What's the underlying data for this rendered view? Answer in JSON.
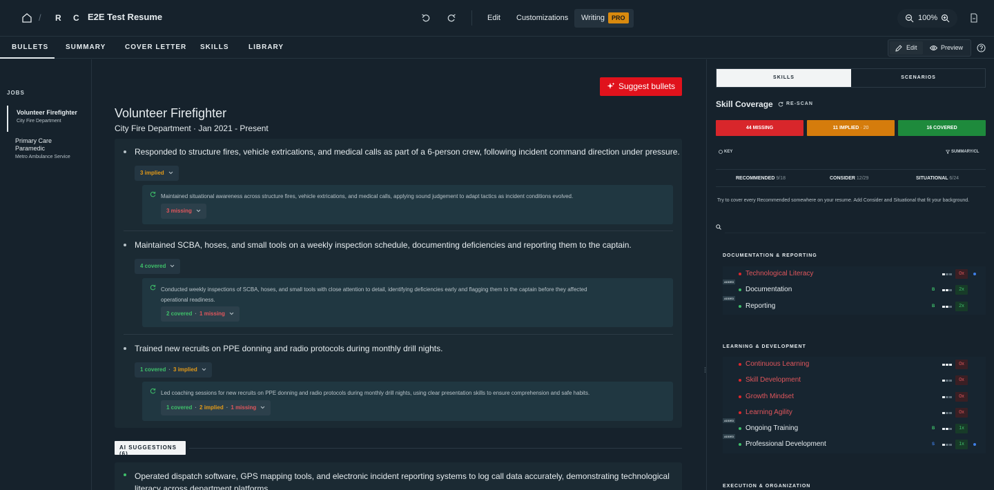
{
  "topbar": {
    "breadcrumb_sep": "/",
    "r": "R",
    "c": "C",
    "doc_title": "E2E Test Resume",
    "edit": "Edit",
    "customizations": "Customizations",
    "writing": "Writing",
    "pro": "PRO",
    "zoom": "100%"
  },
  "tabs": [
    "BULLETS",
    "SUMMARY",
    "COVER LETTER",
    "SKILLS",
    "LIBRARY"
  ],
  "view_toggle": {
    "edit": "Edit",
    "preview": "Preview"
  },
  "sidebar": {
    "heading": "JOBS",
    "jobs": [
      {
        "title": "Volunteer Firefighter",
        "org": "City Fire Department"
      },
      {
        "title_line1": "Primary Care",
        "title_line2": "Paramedic",
        "org": "Metro Ambulance Service"
      }
    ]
  },
  "main": {
    "suggest_button": "Suggest bullets",
    "job_title": "Volunteer Firefighter",
    "job_subtitle": "City Fire Department · Jan 2021 - Present",
    "bullets": [
      {
        "text": "Responded to structure fires, vehicle extrications, and medical calls as part of a 6-person crew, following incident command direction under pressure.",
        "pill": {
          "implied": "3 implied"
        },
        "rewrite": "Maintained situational awareness across structure fires, vehicle extrications, and medical calls, applying sound judgement to adapt tactics as incident conditions evolved.",
        "rewrite_pill": {
          "missing": "3 missing"
        }
      },
      {
        "text": "Maintained SCBA, hoses, and small tools on a weekly inspection schedule, documenting deficiencies and reporting them to the captain.",
        "pill": {
          "covered": "4 covered"
        },
        "rewrite_line1": "Conducted weekly inspections of SCBA, hoses, and small tools with close attention to detail, identifying deficiencies early and flagging them to the captain before they affected",
        "rewrite_line2": "operational readiness.",
        "rewrite_pill": {
          "covered": "2 covered",
          "missing": "1 missing"
        }
      },
      {
        "text": "Trained new recruits on PPE donning and radio protocols during monthly drill nights.",
        "pill": {
          "covered": "1 covered",
          "implied": "3 implied"
        },
        "rewrite": "Led coaching sessions for new recruits on PPE donning and radio protocols during monthly drill nights, using clear presentation skills to ensure comprehension and safe habits.",
        "rewrite_pill": {
          "covered": "1 covered",
          "implied": "2 implied",
          "missing": "1 missing"
        }
      }
    ],
    "ai_tag": "AI SUGGESTIONS (6)",
    "ai_suggestion_line1": "Operated dispatch software, GPS mapping tools, and electronic incident reporting systems to log call data accurately, demonstrating technological",
    "ai_suggestion_line2": "literacy across department platforms."
  },
  "panel": {
    "tab_skills": "SKILLS",
    "tab_scenarios": "SCENARIOS",
    "title": "Skill Coverage",
    "rescan": "RE-SCAN",
    "missing": "44 MISSING",
    "implied": "11 IMPLIED",
    "implied_extra": "· 20",
    "covered": "16 COVERED",
    "key": "KEY",
    "summary_filter": "SUMMARY/CL",
    "recommended": "RECOMMENDED",
    "recommended_count": "9/18",
    "consider": "CONSIDER",
    "consider_count": "12/29",
    "situational": "SITUATIONAL",
    "situational_count": "6/24",
    "hint": "Try to cover every Recommended somewhere on your resume. Add Consider and Situational that fit your background.",
    "added_label": "ADDED",
    "sections": [
      {
        "title": "DOCUMENTATION & REPORTING",
        "skills": [
          {
            "name": "Technological Literacy",
            "status": "missing",
            "letter": "",
            "bars": 1,
            "count": "0x",
            "blue": true
          },
          {
            "name": "Documentation",
            "status": "added",
            "letter": "B",
            "bars": 2,
            "count": "2x",
            "blue": false
          },
          {
            "name": "Reporting",
            "status": "added",
            "letter": "B",
            "bars": 2,
            "count": "2x",
            "blue": false
          }
        ]
      },
      {
        "title": "LEARNING & DEVELOPMENT",
        "skills": [
          {
            "name": "Continuous Learning",
            "status": "missing",
            "letter": "",
            "bars": 3,
            "count": "0x",
            "blue": false
          },
          {
            "name": "Skill Development",
            "status": "missing",
            "letter": "",
            "bars": 1,
            "count": "0x",
            "blue": false
          },
          {
            "name": "Growth Mindset",
            "status": "missing",
            "letter": "",
            "bars": 1,
            "count": "0x",
            "blue": false
          },
          {
            "name": "Learning Agility",
            "status": "missing",
            "letter": "",
            "bars": 1,
            "count": "0x",
            "blue": false
          },
          {
            "name": "Ongoing Training",
            "status": "added",
            "letter": "B",
            "bars": 2,
            "count": "1x",
            "blue": false
          },
          {
            "name": "Professional Development",
            "status": "added",
            "letter": "S",
            "bars": 1,
            "count": "1x",
            "blue": true
          }
        ]
      },
      {
        "title": "EXECUTION & ORGANIZATION",
        "skills": []
      }
    ]
  },
  "colors": {
    "missing": "#d8262b",
    "implied": "#d57c0c",
    "covered": "#1e8a3c",
    "suggest": "#e0121c",
    "pro": "#d98a0e"
  }
}
